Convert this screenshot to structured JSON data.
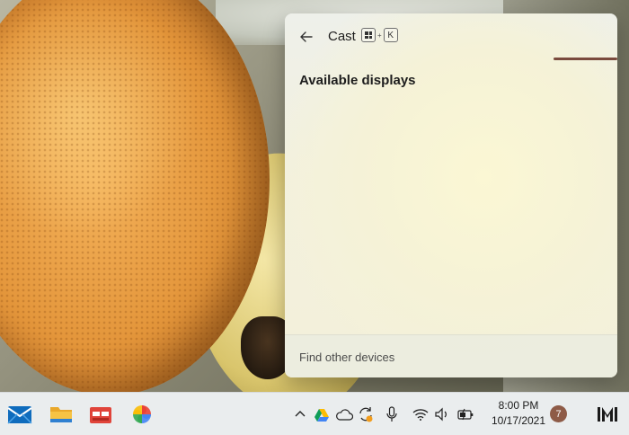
{
  "cast_panel": {
    "title": "Cast",
    "shortcut": {
      "modifier": "windows-key",
      "plus": "+",
      "key": "K"
    },
    "section_heading": "Available displays",
    "footer_link": "Find other devices",
    "accent_color": "#7a4a3d"
  },
  "taskbar": {
    "apps": [
      {
        "name": "Mail",
        "icon": "mail-icon"
      },
      {
        "name": "File Explorer",
        "icon": "folder-icon"
      },
      {
        "name": "Microsoft Store",
        "icon": "store-icon"
      },
      {
        "name": "Google Photos",
        "icon": "pinwheel-icon"
      }
    ],
    "tray": [
      "chevron-up-icon",
      "google-drive-icon",
      "onedrive-cloud-icon",
      "sync-icon",
      "microphone-icon",
      "wifi-icon",
      "speaker-icon",
      "battery-charging-icon"
    ],
    "clock": {
      "time": "8:00 PM",
      "date": "10/17/2021"
    },
    "notification_count": "7",
    "watermark": "M"
  }
}
